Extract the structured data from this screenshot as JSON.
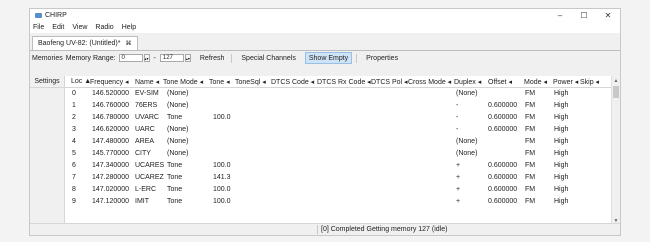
{
  "window": {
    "title": "CHIRP",
    "minimize_glyph": "–",
    "maximize_glyph": "☐",
    "close_glyph": "✕"
  },
  "menu": [
    "File",
    "Edit",
    "View",
    "Radio",
    "Help"
  ],
  "tab": {
    "label": "Baofeng UV-82: (Untitled)*",
    "close_glyph": "⌘"
  },
  "toolbar": {
    "memories_label": "Memories",
    "range_label": "Memory Range:",
    "range_start": "0",
    "range_sep": "-",
    "range_end": "127",
    "refresh_label": "Refresh",
    "special_channels_label": "Special Channels",
    "show_empty_label": "Show Empty",
    "properties_label": "Properties"
  },
  "settings_label": "Settings",
  "columns": [
    "Loc ▲",
    "Frequency ◂",
    "Name ◂",
    "Tone Mode ◂",
    "Tone ◂",
    "ToneSql ◂",
    "DTCS Code ◂",
    "DTCS Rx Code ◂",
    "DTCS Pol ◂",
    "Cross Mode ◂",
    "Duplex ◂",
    "Offset ◂",
    "Mode ◂",
    "Power ◂",
    "Skip ◂"
  ],
  "rows": [
    {
      "loc": "0",
      "freq": "146.520000",
      "name": "EV-SIM",
      "tmode": "(None)",
      "tone": "",
      "duplex": "(None)",
      "offset": "",
      "mode": "FM",
      "power": "High"
    },
    {
      "loc": "1",
      "freq": "146.760000",
      "name": "76ERS",
      "tmode": "(None)",
      "tone": "",
      "duplex": "-",
      "offset": "0.600000",
      "mode": "FM",
      "power": "High"
    },
    {
      "loc": "2",
      "freq": "146.780000",
      "name": "UVARC",
      "tmode": "Tone",
      "tone": "100.0",
      "duplex": "-",
      "offset": "0.600000",
      "mode": "FM",
      "power": "High"
    },
    {
      "loc": "3",
      "freq": "146.620000",
      "name": "UARC",
      "tmode": "(None)",
      "tone": "",
      "duplex": "-",
      "offset": "0.600000",
      "mode": "FM",
      "power": "High"
    },
    {
      "loc": "4",
      "freq": "147.480000",
      "name": "AREA",
      "tmode": "(None)",
      "tone": "",
      "duplex": "(None)",
      "offset": "",
      "mode": "FM",
      "power": "High"
    },
    {
      "loc": "5",
      "freq": "145.770000",
      "name": "CITY",
      "tmode": "(None)",
      "tone": "",
      "duplex": "(None)",
      "offset": "",
      "mode": "FM",
      "power": "High"
    },
    {
      "loc": "6",
      "freq": "147.340000",
      "name": "UCARES",
      "tmode": "Tone",
      "tone": "100.0",
      "duplex": "+",
      "offset": "0.600000",
      "mode": "FM",
      "power": "High"
    },
    {
      "loc": "7",
      "freq": "147.280000",
      "name": "UCAREZ",
      "tmode": "Tone",
      "tone": "141.3",
      "duplex": "+",
      "offset": "0.600000",
      "mode": "FM",
      "power": "High"
    },
    {
      "loc": "8",
      "freq": "147.020000",
      "name": "L-ERC",
      "tmode": "Tone",
      "tone": "100.0",
      "duplex": "+",
      "offset": "0.600000",
      "mode": "FM",
      "power": "High"
    },
    {
      "loc": "9",
      "freq": "147.120000",
      "name": "IMIT",
      "tmode": "Tone",
      "tone": "100.0",
      "duplex": "+",
      "offset": "0.600000",
      "mode": "FM",
      "power": "High"
    }
  ],
  "status": "[0] Completed Getting memory 127 (idle)"
}
